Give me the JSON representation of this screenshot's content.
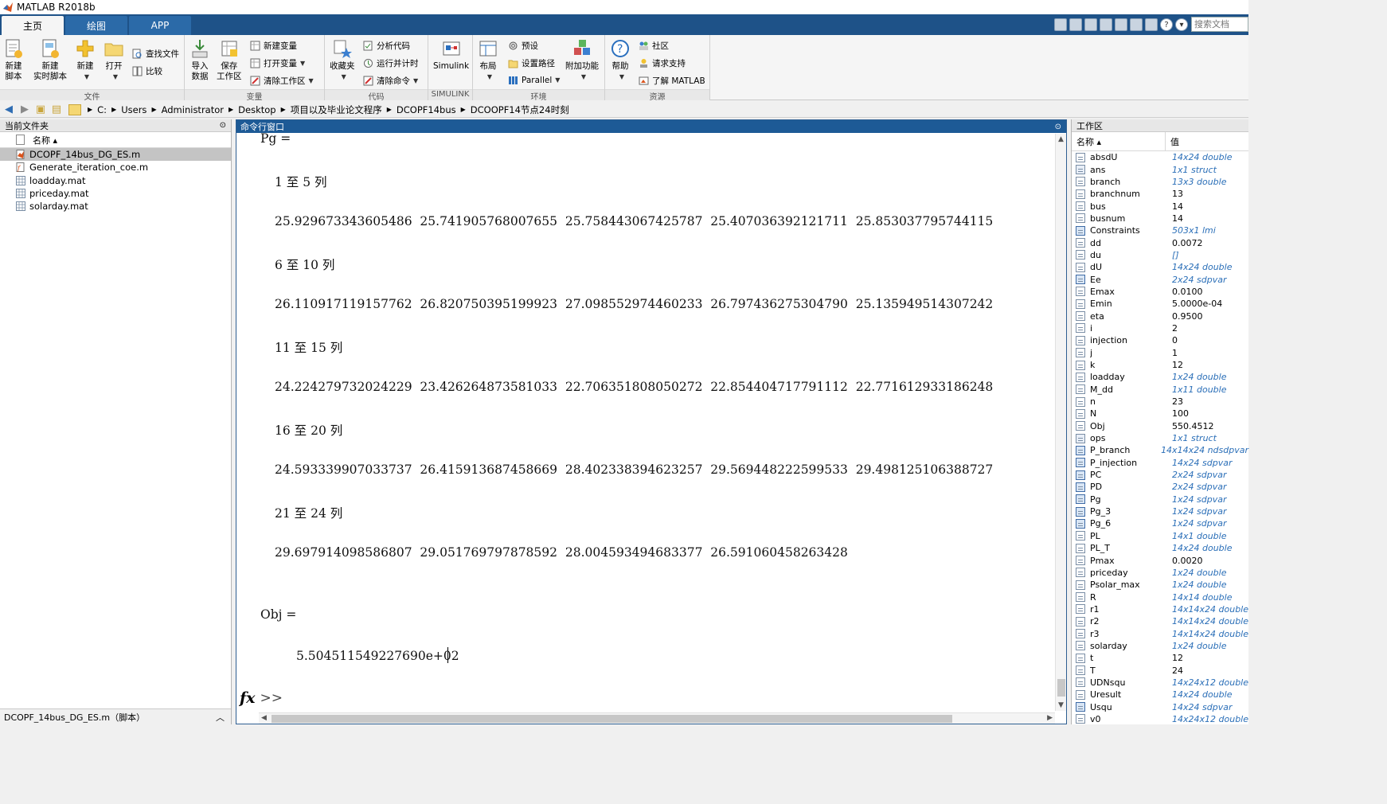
{
  "app": {
    "title": "MATLAB R2018b"
  },
  "tabs": [
    {
      "label": "主页",
      "active": true
    },
    {
      "label": "绘图",
      "active": false
    },
    {
      "label": "APP",
      "active": false
    }
  ],
  "search": {
    "placeholder": "搜索文档"
  },
  "ribbon": {
    "file": {
      "label": "文件",
      "new_script": [
        "新建",
        "脚本"
      ],
      "new_live_script": [
        "新建",
        "实时脚本"
      ],
      "new": "新建",
      "open": "打开",
      "find_files": "查找文件",
      "compare": "比较"
    },
    "variable": {
      "label": "变量",
      "import": [
        "导入",
        "数据"
      ],
      "save_ws": [
        "保存",
        "工作区"
      ],
      "new_var": "新建变量",
      "open_var": "打开变量",
      "clear_ws": "清除工作区"
    },
    "code": {
      "label": "代码",
      "favorites": "收藏夹",
      "analyze": "分析代码",
      "run_time": "运行并计时",
      "clear_cmd": "清除命令"
    },
    "simulink": {
      "label": "SIMULINK",
      "button": "Simulink"
    },
    "env": {
      "label": "环境",
      "layout": "布局",
      "prefs": "预设",
      "set_path": "设置路径",
      "parallel": "Parallel",
      "addons": "附加功能"
    },
    "resources": {
      "label": "资源",
      "help": "帮助",
      "community": "社区",
      "support": "请求支持",
      "learn": "了解 MATLAB"
    }
  },
  "address": [
    "C:",
    "Users",
    "Administrator",
    "Desktop",
    "项目以及毕业论文程序",
    "DCOPF14bus",
    "DCOOPF14节点24时刻"
  ],
  "left_panel": {
    "title": "当前文件夹",
    "col_name": "名称 ▴",
    "files": [
      {
        "name": "DCOPF_14bus_DG_ES.m",
        "type": "m",
        "selected": true
      },
      {
        "name": "Generate_iteration_coe.m",
        "type": "mfunc",
        "selected": false
      },
      {
        "name": "loadday.mat",
        "type": "mat",
        "selected": false
      },
      {
        "name": "priceday.mat",
        "type": "mat",
        "selected": false
      },
      {
        "name": "solarday.mat",
        "type": "mat",
        "selected": false
      }
    ],
    "details": "DCOPF_14bus_DG_ES.m（脚本）"
  },
  "cmd": {
    "title": "命令行窗口",
    "lines": [
      {
        "text": "Pg =",
        "indent": 0
      },
      {
        "text": "1 至 5 列",
        "indent": 1
      },
      {
        "text": "25.929673343605486  25.741905768007655  25.758443067425787  25.407036392121711  25.853037795744115",
        "indent": 1
      },
      {
        "text": "6 至 10 列",
        "indent": 1
      },
      {
        "text": "26.110917119157762  26.820750395199923  27.098552974460233  26.797436275304790  25.135949514307242",
        "indent": 1
      },
      {
        "text": "11 至 15 列",
        "indent": 1
      },
      {
        "text": "24.224279732024229  23.426264873581033  22.706351808050272  22.854404717791112  22.771612933186248",
        "indent": 1
      },
      {
        "text": "16 至 20 列",
        "indent": 1
      },
      {
        "text": "24.593339907033737  26.415913687458669  28.402338394623257  29.569448222599533  29.498125106388727",
        "indent": 1
      },
      {
        "text": "21 至 24 列",
        "indent": 1
      },
      {
        "text": "29.697914098586807  29.051769797878592  28.004593494683377  26.591060458263428",
        "indent": 1
      },
      {
        "text": "Obj =",
        "indent": 0
      },
      {
        "text": "5.504511549227690e+02",
        "indent": 2
      }
    ],
    "prompt_fx": "fx",
    "prompt": ">>"
  },
  "workspace": {
    "title": "工作区",
    "col_name": "名称 ▴",
    "col_value": "值",
    "vars": [
      {
        "name": "absdU",
        "value": "14x24 double",
        "italic": true,
        "icon": "matrix"
      },
      {
        "name": "ans",
        "value": "1x1 struct",
        "italic": true,
        "icon": "struct"
      },
      {
        "name": "branch",
        "value": "13x3 double",
        "italic": true,
        "icon": "matrix"
      },
      {
        "name": "branchnum",
        "value": "13",
        "italic": false,
        "icon": "matrix"
      },
      {
        "name": "bus",
        "value": "14",
        "italic": false,
        "icon": "matrix"
      },
      {
        "name": "busnum",
        "value": "14",
        "italic": false,
        "icon": "matrix"
      },
      {
        "name": "Constraints",
        "value": "503x1 lmi",
        "italic": true,
        "icon": "lmi"
      },
      {
        "name": "dd",
        "value": "0.0072",
        "italic": false,
        "icon": "matrix"
      },
      {
        "name": "du",
        "value": "[]",
        "italic": true,
        "icon": "matrix"
      },
      {
        "name": "dU",
        "value": "14x24 double",
        "italic": true,
        "icon": "matrix"
      },
      {
        "name": "Ee",
        "value": "2x24 sdpvar",
        "italic": true,
        "icon": "lmi"
      },
      {
        "name": "Emax",
        "value": "0.0100",
        "italic": false,
        "icon": "matrix"
      },
      {
        "name": "Emin",
        "value": "5.0000e-04",
        "italic": false,
        "icon": "matrix"
      },
      {
        "name": "eta",
        "value": "0.9500",
        "italic": false,
        "icon": "matrix"
      },
      {
        "name": "i",
        "value": "2",
        "italic": false,
        "icon": "matrix"
      },
      {
        "name": "injection",
        "value": "0",
        "italic": false,
        "icon": "matrix"
      },
      {
        "name": "j",
        "value": "1",
        "italic": false,
        "icon": "matrix"
      },
      {
        "name": "k",
        "value": "12",
        "italic": false,
        "icon": "matrix"
      },
      {
        "name": "loadday",
        "value": "1x24 double",
        "italic": true,
        "icon": "matrix"
      },
      {
        "name": "M_dd",
        "value": "1x11 double",
        "italic": true,
        "icon": "matrix"
      },
      {
        "name": "n",
        "value": "23",
        "italic": false,
        "icon": "matrix"
      },
      {
        "name": "N",
        "value": "100",
        "italic": false,
        "icon": "matrix"
      },
      {
        "name": "Obj",
        "value": "550.4512",
        "italic": false,
        "icon": "matrix"
      },
      {
        "name": "ops",
        "value": "1x1 struct",
        "italic": true,
        "icon": "struct"
      },
      {
        "name": "P_branch",
        "value": "14x14x24 ndsdpvar",
        "italic": true,
        "icon": "lmi"
      },
      {
        "name": "P_injection",
        "value": "14x24 sdpvar",
        "italic": true,
        "icon": "lmi"
      },
      {
        "name": "PC",
        "value": "2x24 sdpvar",
        "italic": true,
        "icon": "lmi"
      },
      {
        "name": "PD",
        "value": "2x24 sdpvar",
        "italic": true,
        "icon": "lmi"
      },
      {
        "name": "Pg",
        "value": "1x24 sdpvar",
        "italic": true,
        "icon": "lmi"
      },
      {
        "name": "Pg_3",
        "value": "1x24 sdpvar",
        "italic": true,
        "icon": "lmi"
      },
      {
        "name": "Pg_6",
        "value": "1x24 sdpvar",
        "italic": true,
        "icon": "lmi"
      },
      {
        "name": "PL",
        "value": "14x1 double",
        "italic": true,
        "icon": "matrix"
      },
      {
        "name": "PL_T",
        "value": "14x24 double",
        "italic": true,
        "icon": "matrix"
      },
      {
        "name": "Pmax",
        "value": "0.0020",
        "italic": false,
        "icon": "matrix"
      },
      {
        "name": "priceday",
        "value": "1x24 double",
        "italic": true,
        "icon": "matrix"
      },
      {
        "name": "Psolar_max",
        "value": "1x24 double",
        "italic": true,
        "icon": "matrix"
      },
      {
        "name": "R",
        "value": "14x14 double",
        "italic": true,
        "icon": "matrix"
      },
      {
        "name": "r1",
        "value": "14x14x24 double",
        "italic": true,
        "icon": "matrix"
      },
      {
        "name": "r2",
        "value": "14x14x24 double",
        "italic": true,
        "icon": "matrix"
      },
      {
        "name": "r3",
        "value": "14x14x24 double",
        "italic": true,
        "icon": "matrix"
      },
      {
        "name": "solarday",
        "value": "1x24 double",
        "italic": true,
        "icon": "matrix"
      },
      {
        "name": "t",
        "value": "12",
        "italic": false,
        "icon": "matrix"
      },
      {
        "name": "T",
        "value": "24",
        "italic": false,
        "icon": "matrix"
      },
      {
        "name": "UDNsqu",
        "value": "14x24x12 double",
        "italic": true,
        "icon": "matrix"
      },
      {
        "name": "Uresult",
        "value": "14x24 double",
        "italic": true,
        "icon": "matrix"
      },
      {
        "name": "Usqu",
        "value": "14x24 sdpvar",
        "italic": true,
        "icon": "lmi"
      },
      {
        "name": "v0",
        "value": "14x24x12 double",
        "italic": true,
        "icon": "matrix"
      }
    ]
  },
  "colors": {
    "tabbar": "#1e5288",
    "cmd_header": "#1d5a96",
    "italic_value": "#2b6fb8"
  }
}
